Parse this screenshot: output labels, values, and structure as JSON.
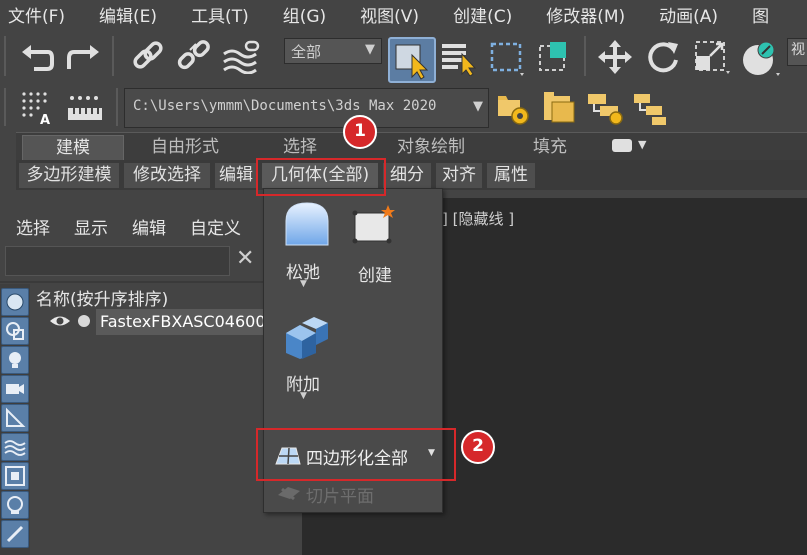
{
  "menubar": {
    "items": [
      "文件(F)",
      "编辑(E)",
      "工具(T)",
      "组(G)",
      "视图(V)",
      "创建(C)",
      "修改器(M)",
      "动画(A)",
      "图"
    ]
  },
  "toolbar": {
    "selection_filter": "全部",
    "path": "C:\\Users\\ymmm\\Documents\\3ds Max 2020",
    "right_partial_label": "视"
  },
  "ribbon": {
    "tabs": [
      "建模",
      "自由形式",
      "选择",
      "对象绘制",
      "填充"
    ],
    "groups": [
      "多边形建模",
      "修改选择",
      "编辑",
      "几何体(全部)",
      "细分",
      "对齐",
      "属性"
    ]
  },
  "scene_explorer": {
    "menu": [
      "选择",
      "显示",
      "编辑",
      "自定义"
    ],
    "column_header": "名称(按升序排序)",
    "item": "FastexFBXASC04600"
  },
  "viewport": {
    "label": "] [隐藏线 ]"
  },
  "dropdown": {
    "relax_label": "松弛",
    "create_label": "创建",
    "attach_label": "附加",
    "quadrify_label": "四边形化全部",
    "slice_plane_label": "切片平面"
  },
  "annotations": {
    "badge1": "1",
    "badge2": "2",
    "highlight_color": "#d6282a"
  }
}
